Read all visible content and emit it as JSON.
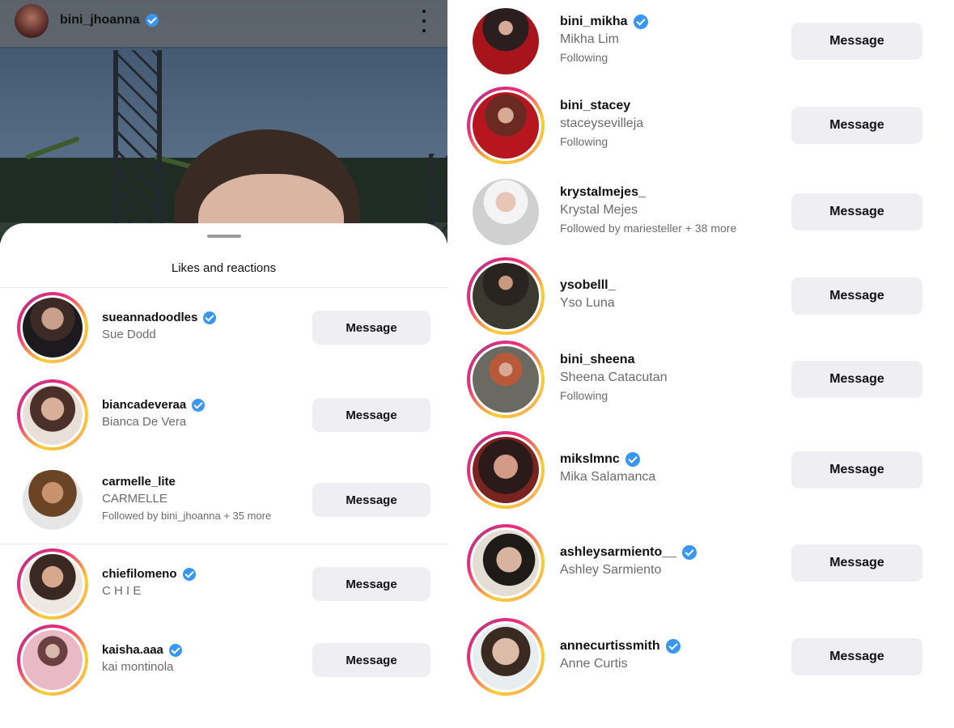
{
  "post_header": {
    "username": "bini_jhoanna",
    "verified": true,
    "more_icon": "vertical-ellipsis-icon"
  },
  "sheet": {
    "title": "Likes and reactions"
  },
  "left_list": [
    {
      "username": "sueannadoodles",
      "verified": true,
      "display_name": "Sue Dodd",
      "subtitle": "",
      "ring": "story",
      "button": "Message"
    },
    {
      "username": "biancadeveraa",
      "verified": true,
      "display_name": "Bianca De Vera",
      "subtitle": "",
      "ring": "story",
      "button": "Message"
    },
    {
      "username": "carmelle_lite",
      "verified": false,
      "display_name": "CARMELLE",
      "subtitle": "Followed by bini_jhoanna + 35 more",
      "ring": "none",
      "button": "Message"
    },
    {
      "username": "chiefilomeno",
      "verified": true,
      "display_name": "C H I E",
      "subtitle": "",
      "ring": "story",
      "button": "Message"
    },
    {
      "username": "kaisha.aaa",
      "verified": true,
      "display_name": "kai montinola",
      "subtitle": "",
      "ring": "story",
      "button": "Message"
    }
  ],
  "right_list": [
    {
      "username": "bini_mikha",
      "verified": true,
      "display_name": "Mikha Lim",
      "subtitle": "Following",
      "ring": "none",
      "button": "Message"
    },
    {
      "username": "bini_stacey",
      "verified": false,
      "display_name": "staceysevilleja",
      "subtitle": "Following",
      "ring": "story",
      "button": "Message"
    },
    {
      "username": "krystalmejes_",
      "verified": false,
      "display_name": "Krystal Mejes",
      "subtitle": "Followed by mariesteller + 38 more",
      "ring": "none",
      "button": "Message"
    },
    {
      "username": "ysobelll_",
      "verified": false,
      "display_name": "Yso Luna",
      "subtitle": "",
      "ring": "story",
      "button": "Message"
    },
    {
      "username": "bini_sheena",
      "verified": false,
      "display_name": "Sheena Catacutan",
      "subtitle": "Following",
      "ring": "story",
      "button": "Message"
    },
    {
      "username": "mikslmnc",
      "verified": true,
      "display_name": "Mika Salamanca",
      "subtitle": "",
      "ring": "story",
      "button": "Message"
    },
    {
      "username": "ashleysarmiento__",
      "verified": true,
      "display_name": "Ashley Sarmiento",
      "subtitle": "",
      "ring": "story",
      "button": "Message"
    },
    {
      "username": "annecurtissmith",
      "verified": true,
      "display_name": "Anne Curtis",
      "subtitle": "",
      "ring": "story",
      "button": "Message"
    }
  ],
  "colors": {
    "verified_blue": "#3897f0",
    "button_bg": "#efeff3",
    "secondary_text": "#6b6b6b",
    "story_ring_yellow": "#f9ce34",
    "story_ring_pink": "#ee2a7b",
    "story_ring_purple": "#c13584"
  }
}
